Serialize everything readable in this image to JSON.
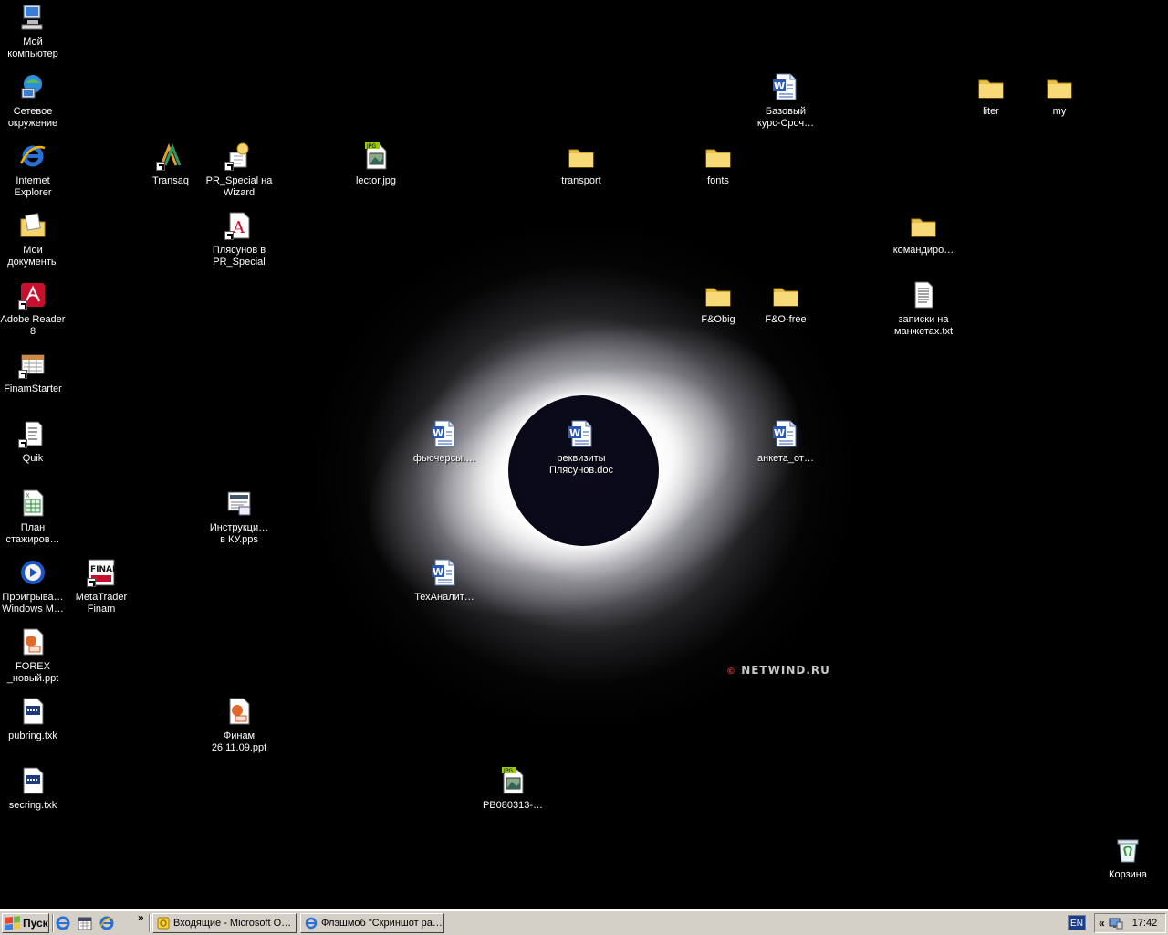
{
  "desktop": {
    "icons": [
      {
        "id": "my-computer",
        "label": "Мой\nкомпьютер",
        "icon": "computer-icon"
      },
      {
        "id": "network",
        "label": "Сетевое\nокружение",
        "icon": "network-icon"
      },
      {
        "id": "ie",
        "label": "Internet\nExplorer",
        "icon": "internet-explorer-icon"
      },
      {
        "id": "my-docs",
        "label": "Мои\nдокументы",
        "icon": "documents-folder-icon"
      },
      {
        "id": "adobe",
        "label": "Adobe Reader\n8",
        "icon": "adobe-reader-icon"
      },
      {
        "id": "finamstarter",
        "label": "FinamStarter",
        "icon": "finamstarter-icon"
      },
      {
        "id": "quik",
        "label": "Quik",
        "icon": "quik-icon"
      },
      {
        "id": "plan",
        "label": "План\nстажиров…",
        "icon": "excel-file-icon"
      },
      {
        "id": "wmp",
        "label": "Проигрыва…\nWindows M…",
        "icon": "media-player-icon"
      },
      {
        "id": "forex",
        "label": "FOREX\n_новый.ppt",
        "icon": "powerpoint-file-icon"
      },
      {
        "id": "pubring",
        "label": "pubring.txk",
        "icon": "key-file-icon"
      },
      {
        "id": "secring",
        "label": "secring.txk",
        "icon": "key-file-icon"
      },
      {
        "id": "metatrader",
        "label": "MetaTrader\nFinam",
        "icon": "finam-logo-icon"
      },
      {
        "id": "transaq",
        "label": "Transaq",
        "icon": "transaq-icon"
      },
      {
        "id": "prspecial-wizard",
        "label": "PR_Special на\nWizard",
        "icon": "wizard-icon"
      },
      {
        "id": "plyasunov-pr",
        "label": "Плясунов в\nPR_Special",
        "icon": "font-file-icon"
      },
      {
        "id": "instrukcii",
        "label": "Инструкци…\nв КУ.pps",
        "icon": "pps-file-icon"
      },
      {
        "id": "finam-ppt",
        "label": "Финам\n26.11.09.ppt",
        "icon": "powerpoint-file-icon"
      },
      {
        "id": "lector",
        "label": "lector.jpg",
        "icon": "jpg-file-icon"
      },
      {
        "id": "futures",
        "label": "фьючерсы….",
        "icon": "word-doc-icon"
      },
      {
        "id": "tehanalit",
        "label": "ТехАналит…",
        "icon": "word-doc-icon"
      },
      {
        "id": "pb080313",
        "label": "PB080313-…",
        "icon": "jpg-file-icon"
      },
      {
        "id": "transport",
        "label": "transport",
        "icon": "folder-icon"
      },
      {
        "id": "rekvizity",
        "label": "реквизиты\nПлясунов.doc",
        "icon": "word-doc-icon"
      },
      {
        "id": "fonts",
        "label": "fonts",
        "icon": "folder-icon"
      },
      {
        "id": "fobig",
        "label": "F&Obig",
        "icon": "folder-icon"
      },
      {
        "id": "bazovy",
        "label": "Базовый\nкурс-Сроч…",
        "icon": "word-doc-icon"
      },
      {
        "id": "fofree",
        "label": "F&O-free",
        "icon": "folder-icon"
      },
      {
        "id": "anketa",
        "label": "анкета_от…",
        "icon": "word-doc-icon"
      },
      {
        "id": "komandiro",
        "label": "командиро…",
        "icon": "folder-icon"
      },
      {
        "id": "zapiski",
        "label": "записки на\nманжетах.txt",
        "icon": "text-file-icon"
      },
      {
        "id": "liter",
        "label": "liter",
        "icon": "folder-icon"
      },
      {
        "id": "my",
        "label": "my",
        "icon": "folder-icon"
      },
      {
        "id": "recycle",
        "label": "Корзина",
        "icon": "recycle-bin-icon"
      }
    ],
    "watermark": "NETWIND.RU",
    "watermark_symbol": "©"
  },
  "taskbar": {
    "start_label": "Пуск",
    "quicklaunch": [
      "internet-explorer-icon",
      "calendar-icon",
      "internet-explorer-icon"
    ],
    "overflow_glyph": "»",
    "tasks": [
      {
        "label": "Входящие - Microsoft O…",
        "icon": "outlook-icon"
      },
      {
        "label": "Флэшмоб \"Скриншот ра…",
        "icon": "internet-explorer-icon"
      }
    ],
    "language": "EN",
    "tray_chevron": "«",
    "clock": "17:42"
  },
  "colors": {
    "taskbar": "#d4d0c8",
    "folder": "#f4d46b",
    "word_blue": "#2b5ab4"
  }
}
